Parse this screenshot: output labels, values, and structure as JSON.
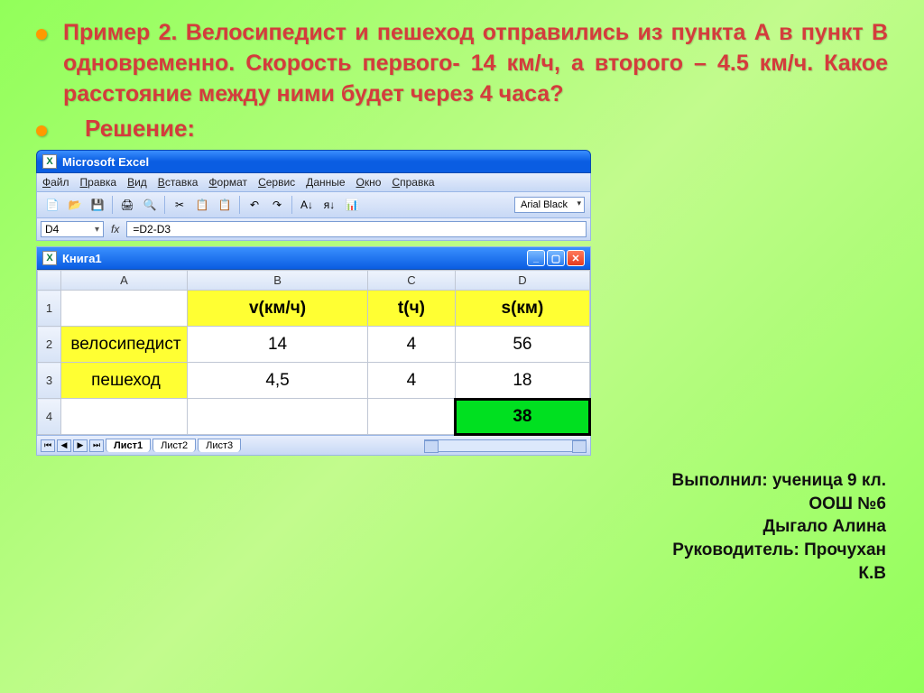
{
  "problem": "Пример 2. Велосипедист и пешеход отправились из пункта А в пункт В одновременно. Скорость первого- 14 км/ч, а второго – 4.5 км/ч. Какое расстояние между ними будет через 4 часа?",
  "solution_label": "Решение:",
  "excel": {
    "app_title": "Microsoft Excel",
    "menu": [
      "Файл",
      "Правка",
      "Вид",
      "Вставка",
      "Формат",
      "Сервис",
      "Данные",
      "Окно",
      "Справка"
    ],
    "font_name": "Arial Black",
    "active_cell": "D4",
    "formula": "=D2-D3",
    "workbook_title": "Книга1",
    "columns": [
      "A",
      "B",
      "C",
      "D"
    ],
    "headers": {
      "B": "v(км/ч)",
      "C": "t(ч)",
      "D": "s(км)"
    },
    "rows": [
      {
        "n": "1"
      },
      {
        "n": "2",
        "A": "велосипедист",
        "B": "14",
        "C": "4",
        "D": "56"
      },
      {
        "n": "3",
        "A": "пешеход",
        "B": "4,5",
        "C": "4",
        "D": "18"
      },
      {
        "n": "4",
        "D": "38"
      }
    ],
    "sheets": [
      "Лист1",
      "Лист2",
      "Лист3"
    ]
  },
  "credits": {
    "l1": "Выполнил: ученица 9 кл.",
    "l2": "ООШ №6",
    "l3": "Дыгало Алина",
    "l4": "Руководитель: Прочухан",
    "l5": "К.В"
  },
  "icons": {
    "new": "📄",
    "open": "📂",
    "save": "💾",
    "print": "🖨",
    "preview": "🔍",
    "cut": "✂",
    "copy": "📋",
    "paste": "📋",
    "undo": "↶",
    "redo": "↷",
    "sort_asc": "A↓",
    "sort_desc": "я↓",
    "chart": "📊"
  }
}
